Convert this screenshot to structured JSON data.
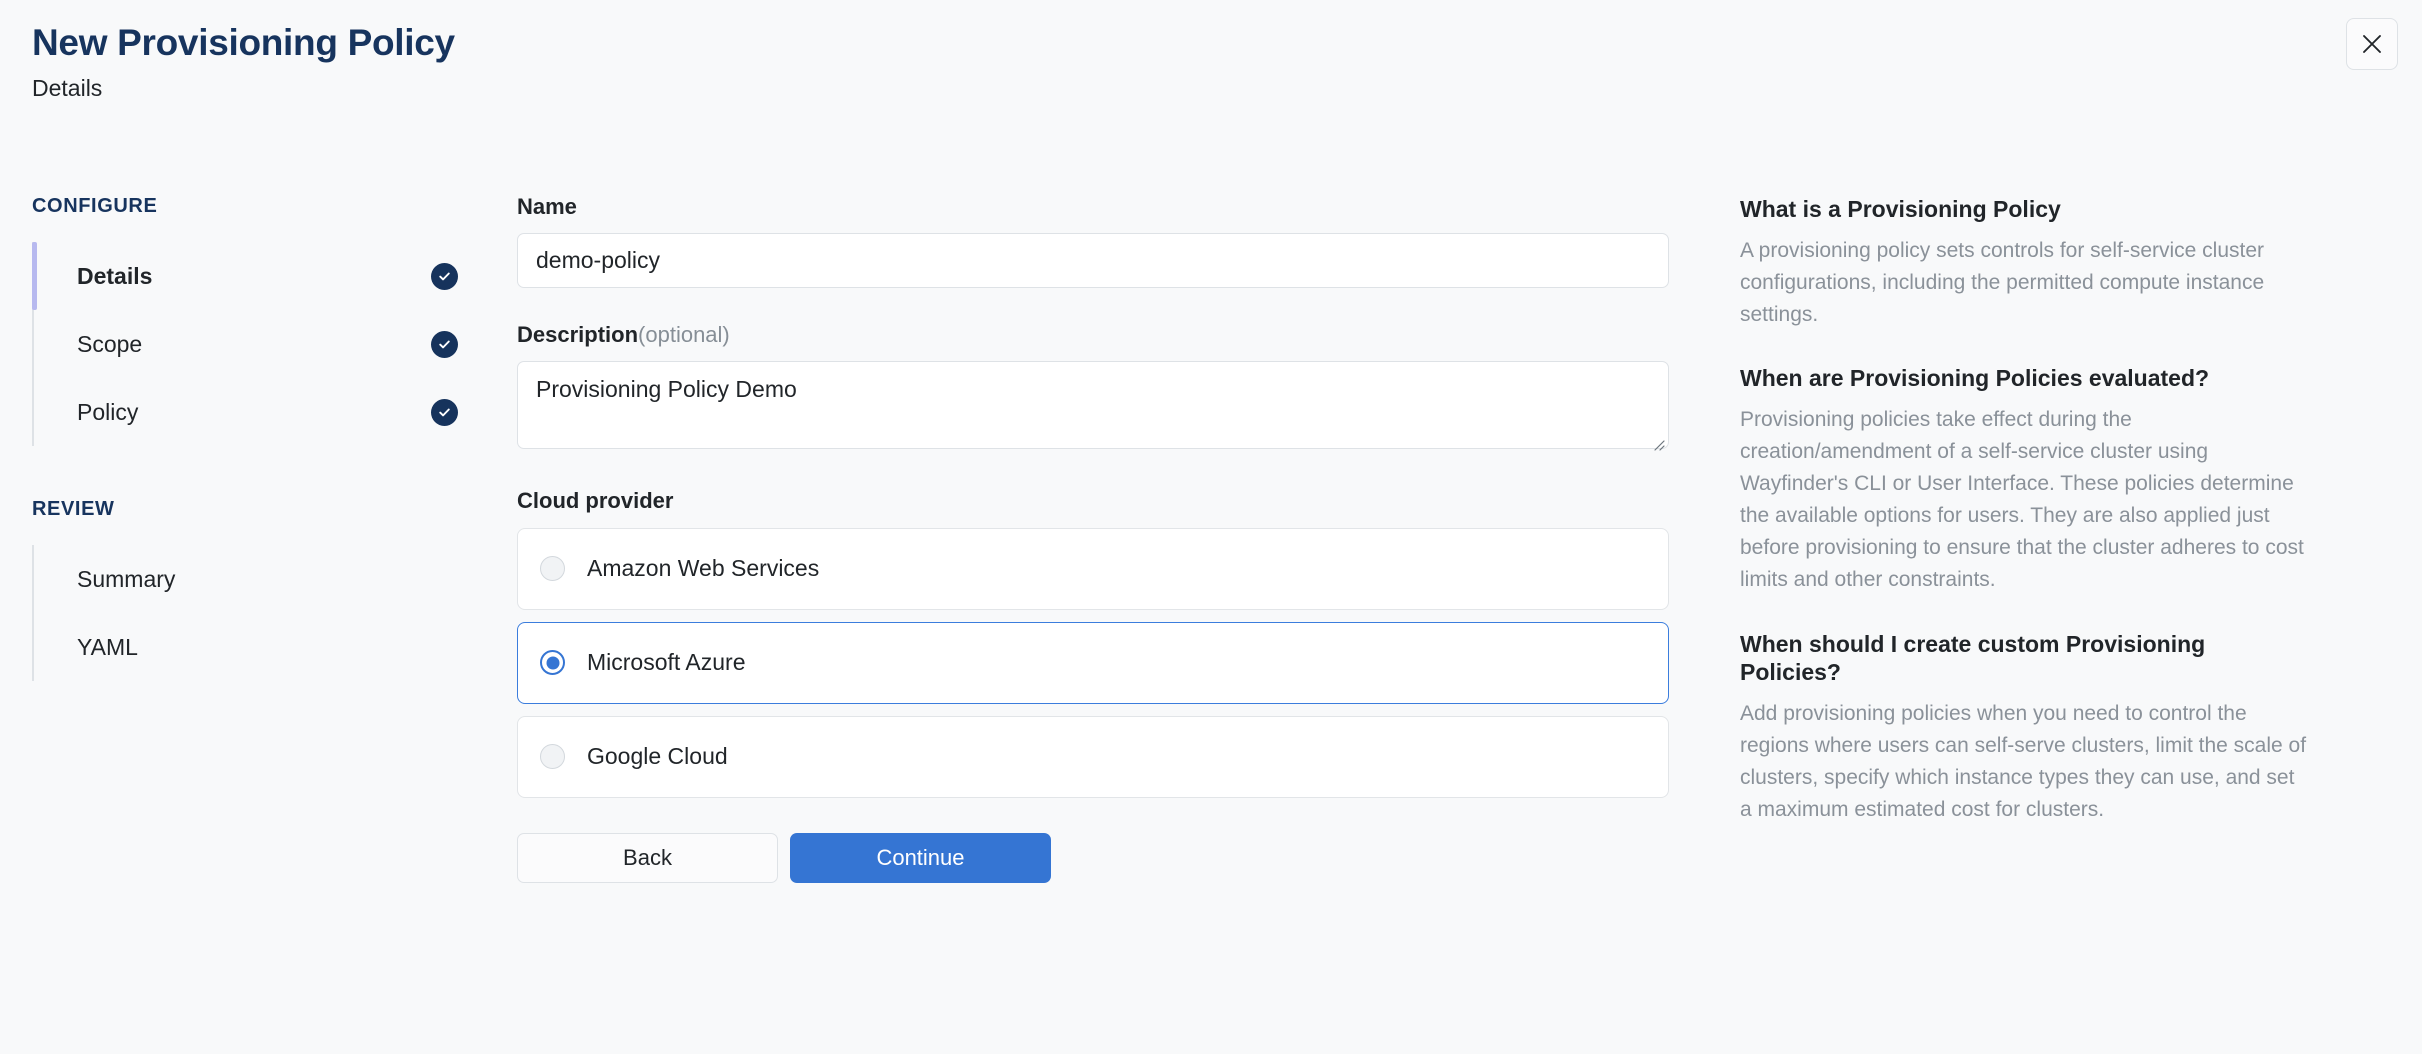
{
  "header": {
    "title": "New Provisioning Policy",
    "subtitle": "Details",
    "close_label": "Close"
  },
  "sidebar": {
    "configure_title": "CONFIGURE",
    "review_title": "REVIEW",
    "configure_items": [
      {
        "label": "Details",
        "active": true,
        "complete": true
      },
      {
        "label": "Scope",
        "active": false,
        "complete": true
      },
      {
        "label": "Policy",
        "active": false,
        "complete": true
      }
    ],
    "review_items": [
      {
        "label": "Summary",
        "active": false,
        "complete": false
      },
      {
        "label": "YAML",
        "active": false,
        "complete": false
      }
    ]
  },
  "form": {
    "name": {
      "label": "Name",
      "value": "demo-policy",
      "placeholder": "Name"
    },
    "description": {
      "label": "Description",
      "optional_suffix": "(optional)",
      "value": "Provisioning Policy Demo",
      "placeholder": "Description"
    },
    "cloud_provider": {
      "label": "Cloud provider",
      "selected": "Microsoft Azure",
      "options": [
        {
          "label": "Amazon Web Services",
          "selected": false
        },
        {
          "label": "Microsoft Azure",
          "selected": true
        },
        {
          "label": "Google Cloud",
          "selected": false
        }
      ]
    },
    "buttons": {
      "back": "Back",
      "continue": "Continue"
    }
  },
  "help": {
    "sections": [
      {
        "heading": "What is a Provisioning Policy",
        "body": "A provisioning policy sets controls for self-service cluster configurations, including the permitted compute instance settings."
      },
      {
        "heading": "When are Provisioning Policies evaluated?",
        "body": "Provisioning policies take effect during the creation/amendment of a self-service cluster using Wayfinder's CLI or User Interface. These policies determine the available options for users. They are also applied just before provisioning to ensure that the cluster adheres to cost limits and other constraints."
      },
      {
        "heading": "When should I create custom Provisioning Policies?",
        "body": "Add provisioning policies when you need to control the regions where users can self-serve clusters, limit the scale of clusters, specify which instance types they can use, and set a maximum estimated cost for clusters."
      }
    ]
  },
  "colors": {
    "accent_blue": "#3575d3",
    "navy": "#17345e",
    "active_bar": "#b7b9ef",
    "page_bg": "#f8f9fa",
    "card_bg": "#ffffff",
    "border": "#dee2e6",
    "muted_text": "#8a9199"
  }
}
